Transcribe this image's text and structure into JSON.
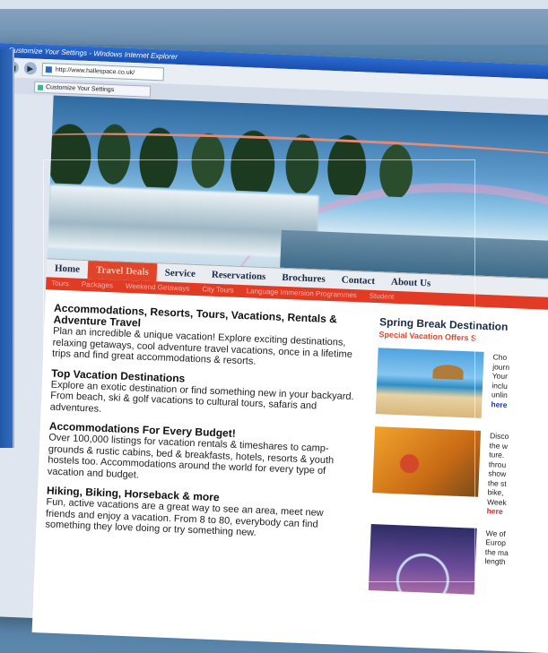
{
  "window": {
    "title": "Customize Your Settings - Windows Internet Explorer",
    "url": "http://www.hallespace.co.uk/",
    "tab_label": "Customize Your Settings"
  },
  "nav": {
    "items": [
      "Home",
      "Travel Deals",
      "Service",
      "Reservations",
      "Brochures",
      "Contact",
      "About Us"
    ],
    "active_index": 1
  },
  "subnav": {
    "items": [
      "Tours",
      "Packages",
      "Weekend Getaways",
      "City Tours",
      "Language Immersion Programmes",
      "Student"
    ]
  },
  "content": {
    "sections": [
      {
        "heading": "Accommodations, Resorts, Tours, Vacations, Rentals & Adventure Travel",
        "body": "Plan an incredible & unique vacation! Explore exciting destinations, relaxing getaways, cool adventure travel vacations, once in a lifetime trips and find great accommodations & resorts."
      },
      {
        "heading": "Top Vacation Destinations",
        "body": "Explore an exotic destination or find something new in your backyard. From beach, ski & golf vacations to cultural tours, safaris and adventures."
      },
      {
        "heading": "Accommodations For Every Budget!",
        "body": "Over 100,000 listings for vacation rentals & timeshares to camp-grounds & rustic cabins, bed & breakfasts, hotels, resorts & youth hostels too. Accommodations around the world for every type of vacation and budget."
      },
      {
        "heading": "Hiking, Biking, Horseback & more",
        "body": "Fun, active vacations are a great way to see an area, meet new friends and enjoy a vacation. From 8 to 80, everybody can find something they love doing or try something new."
      }
    ]
  },
  "sidebar": {
    "title": "Spring Break Destination",
    "subtitle": "Special Vacation Offers S",
    "promos": [
      {
        "image": "beach-photo",
        "lines": [
          "Cho",
          "journ",
          "Your",
          "inclu",
          "unlin"
        ],
        "link": "here",
        "link_color": "#2233aa"
      },
      {
        "image": "hiker-photo",
        "lines": [
          "Disco",
          "the w",
          "ture.",
          "throu",
          "show",
          "the st",
          "bike,",
          "Week"
        ],
        "link": "here",
        "link_color": "#d22222"
      },
      {
        "image": "ferris-wheel-photo",
        "lines": [
          "We of",
          "Europ",
          "the ma",
          "length"
        ],
        "link": "",
        "link_color": "#2233aa"
      }
    ]
  },
  "colors": {
    "accent_red": "#e0452a",
    "nav_text": "#1c2a44",
    "titlebar_blue": "#2c6bd0"
  }
}
